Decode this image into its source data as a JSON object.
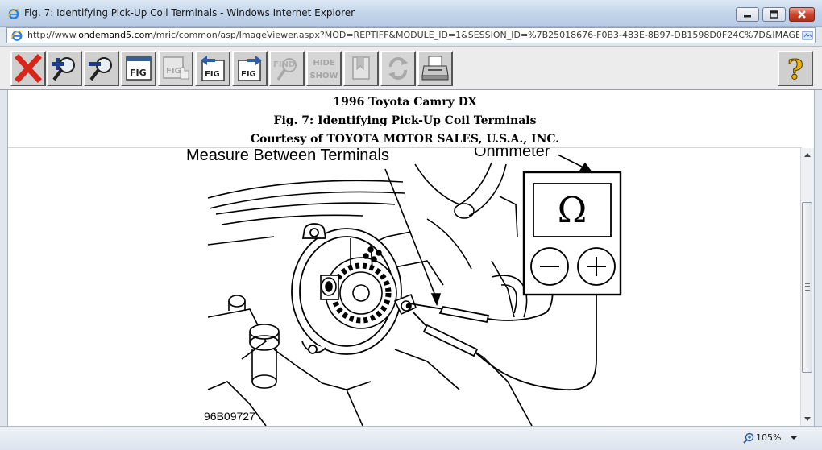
{
  "window": {
    "title": "Fig. 7: Identifying Pick-Up Coil Terminals - Windows Internet Explorer"
  },
  "address": {
    "url_prefix": "http://www.",
    "url_domain": "ondemand5.com",
    "url_rest": "/mric/common/asp/ImageViewer.aspx?MOD=REPTIFF&MODULE_ID=1&SESSION_ID=%7B25018676-F0B3-483E-8B97-DB1598D0F24C%7D&IMAGE_GUID"
  },
  "toolbar": {
    "buttons": [
      {
        "icon": "close-x-icon",
        "enabled": true
      },
      {
        "icon": "zoom-in-icon",
        "enabled": true
      },
      {
        "icon": "zoom-out-icon",
        "enabled": true
      },
      {
        "icon": "fig-window-icon",
        "enabled": true
      },
      {
        "icon": "fig-hand-icon",
        "enabled": false
      },
      {
        "icon": "fig-previous-icon",
        "enabled": true
      },
      {
        "icon": "fig-next-icon",
        "enabled": true
      },
      {
        "icon": "find-icon",
        "enabled": false
      },
      {
        "icon": "hide-show-icon",
        "enabled": false
      },
      {
        "icon": "bookmark-icon",
        "enabled": false
      },
      {
        "icon": "refresh-icon",
        "enabled": false
      },
      {
        "icon": "print-icon",
        "enabled": true
      },
      {
        "icon": "help-icon",
        "enabled": true
      }
    ],
    "fig_text": "FIG",
    "find_text": "FIND",
    "hide_text": "HIDE",
    "show_text": "SHOW",
    "help_text": "?"
  },
  "caption": {
    "line1": "1996 Toyota Camry DX",
    "line2": "Fig. 7: Identifying Pick-Up Coil Terminals",
    "line3": "Courtesy of TOYOTA MOTOR SALES, U.S.A., INC."
  },
  "figure": {
    "label_measure": "Measure Between Terminals",
    "label_ohmmeter": "Ohmmeter",
    "meter_symbol": "Ω",
    "ref_code": "96B09727"
  },
  "status": {
    "zoom": "105%"
  },
  "colors": {
    "close_red": "#d9261c",
    "help_yellow": "#e8b400"
  }
}
